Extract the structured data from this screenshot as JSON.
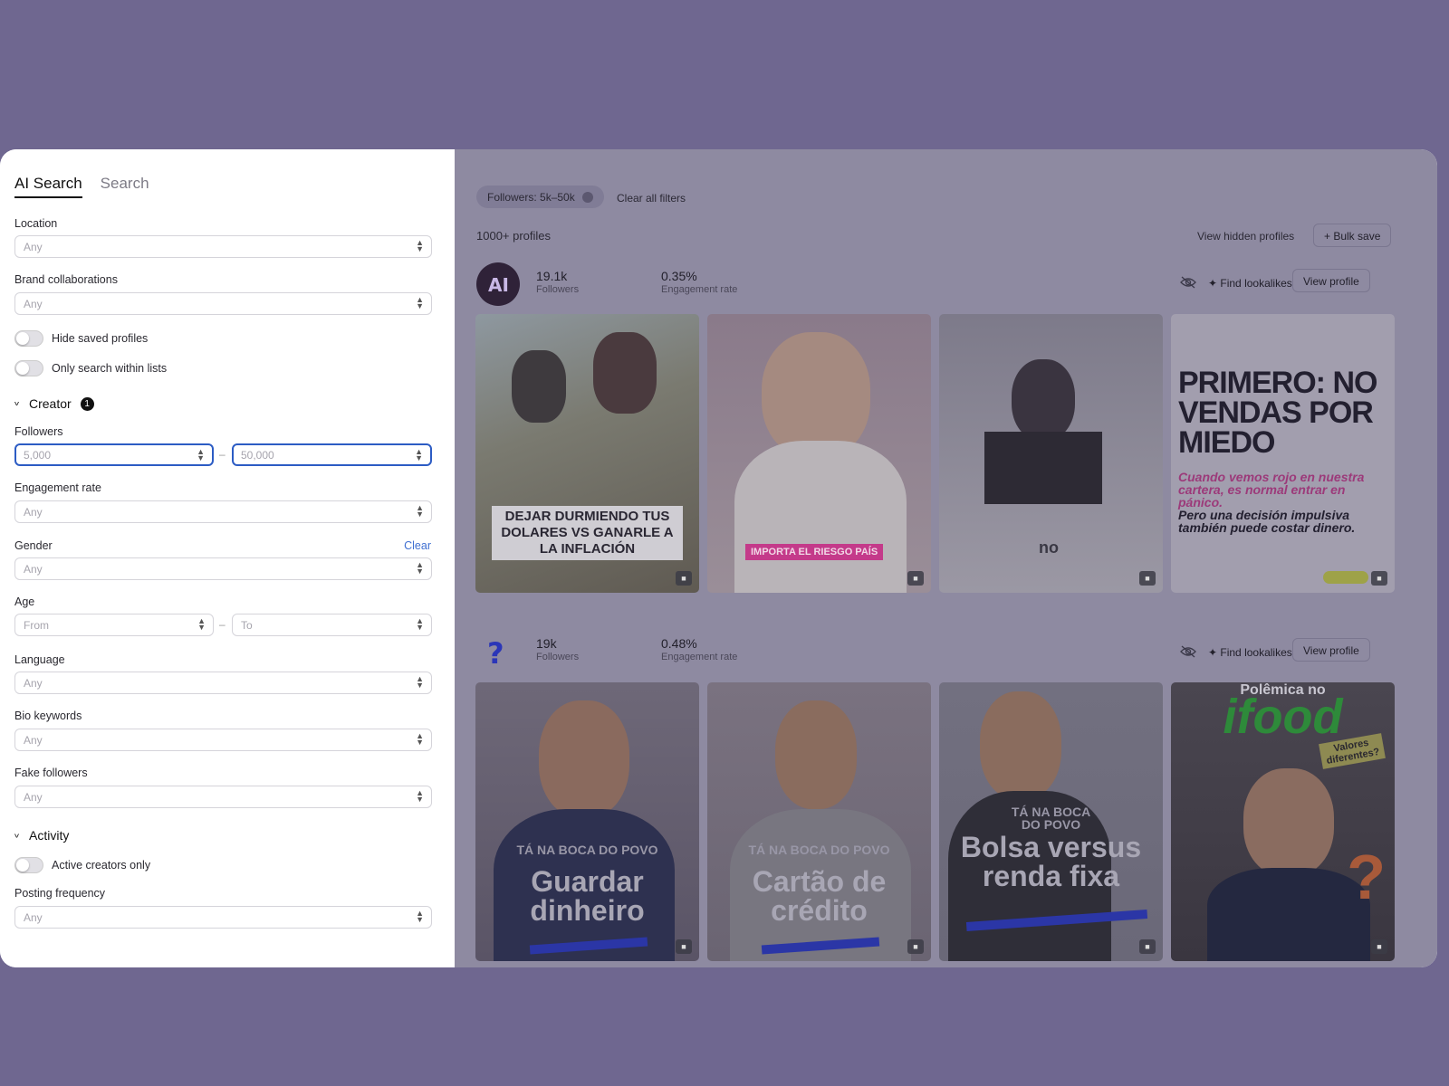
{
  "tabs": [
    "AI Search",
    "Search"
  ],
  "filters": {
    "location": {
      "label": "Location",
      "value": "Any"
    },
    "brand": {
      "label": "Brand collaborations",
      "value": "Any"
    },
    "hide_saved": "Hide saved profiles",
    "only_lists": "Only search within lists",
    "creator": {
      "label": "Creator",
      "badge": "1"
    },
    "followers": {
      "label": "Followers",
      "from": "5,000",
      "to": "50,000",
      "dash": "–"
    },
    "engagement": {
      "label": "Engagement rate",
      "value": "Any"
    },
    "gender": {
      "label": "Gender",
      "value": "Any",
      "clear": "Clear"
    },
    "age": {
      "label": "Age",
      "from": "From",
      "to": "To",
      "dash": "–"
    },
    "language": {
      "label": "Language",
      "value": "Any"
    },
    "bio": {
      "label": "Bio keywords",
      "value": "Any"
    },
    "fake": {
      "label": "Fake followers",
      "value": "Any"
    },
    "activity": {
      "label": "Activity"
    },
    "active_only": "Active creators only",
    "posting": {
      "label": "Posting frequency",
      "value": "Any"
    }
  },
  "results": {
    "chip": "Followers: 5k–50k",
    "clear_all": "Clear all filters",
    "count": "1000+ profiles",
    "view_hidden": "View hidden profiles",
    "bulk_save": "+ Bulk save"
  },
  "profiles": [
    {
      "followers": "19.1k",
      "followers_label": "Followers",
      "engagement": "0.35%",
      "engagement_label": "Engagement rate",
      "lookalikes": "Find lookalikes",
      "view": "View profile",
      "captions": [
        "DEJAR DURMIENDO TUS DOLARES VS GANARLE A LA INFLACIÓN",
        "IMPORTA EL RIESGO PAÍS",
        "no",
        "PRIMERO: NO VENDAS POR MIEDO",
        "Cuando vemos rojo en nuestra cartera, es normal entrar en pánico.",
        "Pero una decisión impulsiva también puede costar dinero."
      ]
    },
    {
      "followers": "19k",
      "followers_label": "Followers",
      "engagement": "0.48%",
      "engagement_label": "Engagement rate",
      "lookalikes": "Find lookalikes",
      "view": "View profile",
      "captions": [
        "TÁ NA BOCA DO POVO",
        "Guardar dinheiro",
        "TÁ NA BOCA DO POVO",
        "Cartão de crédito",
        "TÁ NA BOCA DO POVO",
        "Bolsa versus renda fixa",
        "Polêmica no",
        "ifood",
        "Valores diferentes?",
        "?"
      ]
    }
  ]
}
